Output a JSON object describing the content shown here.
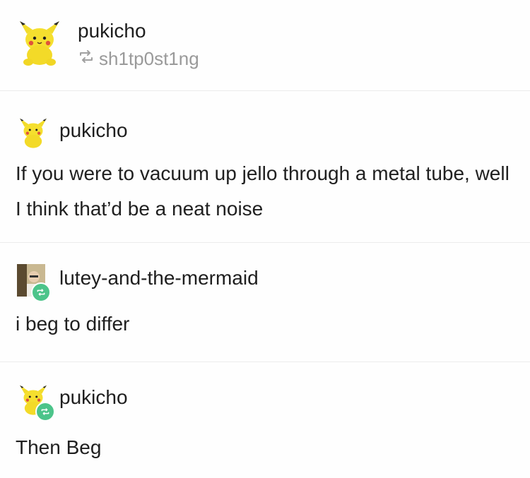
{
  "header": {
    "username": "pukicho",
    "reblogged_from": "sh1tp0st1ng",
    "avatar_icon": "pikachu-avatar-icon",
    "reblog_icon": "reblog-icon"
  },
  "posts": [
    {
      "author": "pukicho",
      "avatar_icon": "pikachu-avatar-icon",
      "text": "If you were to vacuum up jello through a metal tube, well I think that’d be a neat noise"
    },
    {
      "author": "lutey-and-the-mermaid",
      "avatar_icon": "photo-avatar-icon",
      "badge_icon": "reblog-badge-icon",
      "text": "i beg to differ"
    },
    {
      "author": "pukicho",
      "avatar_icon": "pikachu-avatar-icon",
      "badge_icon": "reblog-badge-icon",
      "text": "Then Beg"
    }
  ],
  "colors": {
    "reblog_badge": "#4cc48a",
    "divider": "#ececec",
    "muted_text": "#9a9a9a"
  }
}
